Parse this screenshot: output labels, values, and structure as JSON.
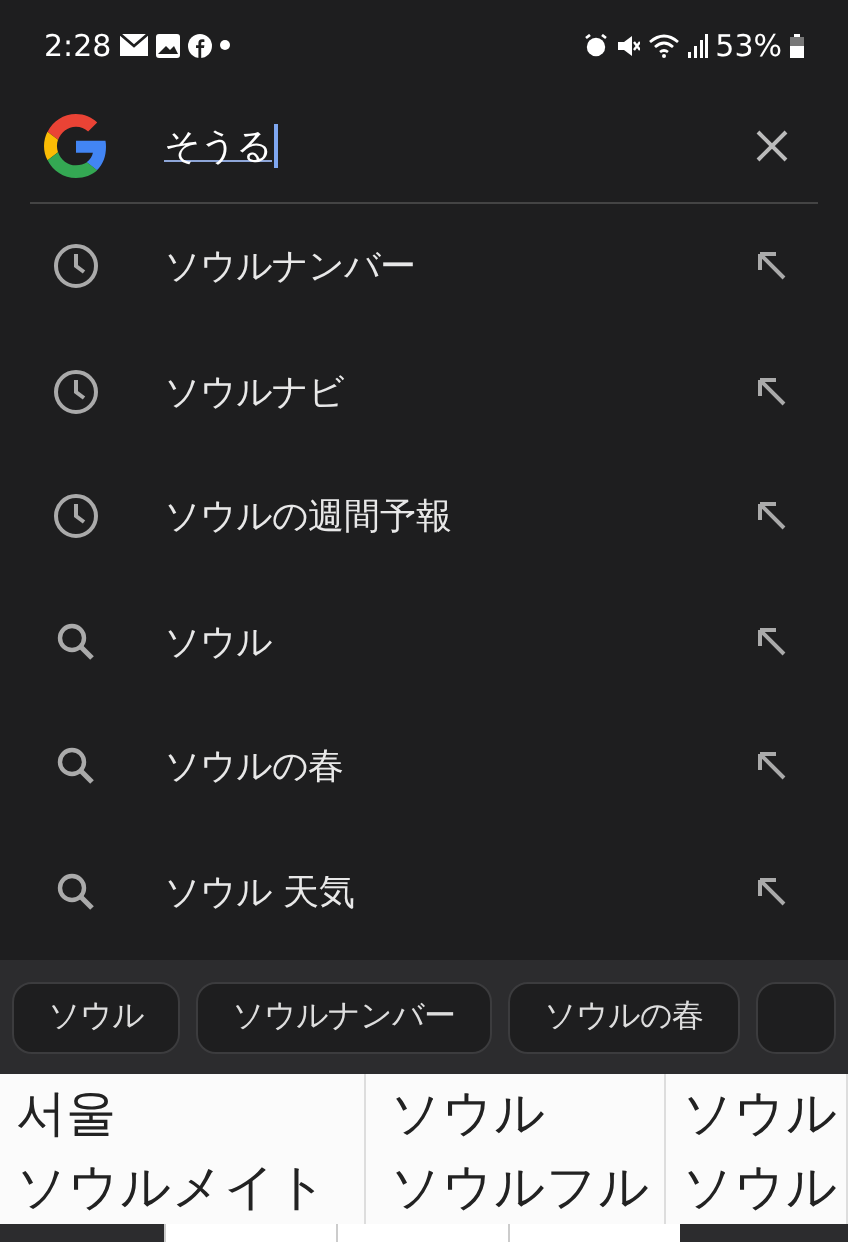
{
  "status_bar": {
    "time": "2:28",
    "battery": "53%"
  },
  "search": {
    "value": "そうる"
  },
  "suggestions": [
    {
      "kind": "history",
      "text": "ソウルナンバー"
    },
    {
      "kind": "history",
      "text": "ソウルナビ"
    },
    {
      "kind": "history",
      "text": "ソウルの週間予報"
    },
    {
      "kind": "search",
      "text": "ソウル"
    },
    {
      "kind": "search",
      "text": "ソウルの春"
    },
    {
      "kind": "search",
      "text": "ソウル 天気"
    }
  ],
  "chips": [
    "ソウル",
    "ソウルナンバー",
    "ソウルの春"
  ],
  "candidates": [
    [
      "서울",
      "ソウルメイト"
    ],
    [
      "ソウル",
      "ソウルフル"
    ],
    [
      "ソウル",
      "ソウル"
    ]
  ]
}
